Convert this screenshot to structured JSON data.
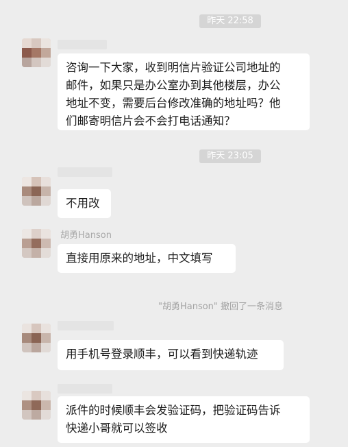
{
  "timestamps": [
    "昨天 22:58",
    "昨天 23:05"
  ],
  "messages": [
    {
      "sender": "",
      "text": "咨询一下大家，收到明信片验证公司地址的\n邮件，如果只是办公室办到其他楼层，办公\n地址不变，需要后台修改准确的地址吗？他\n们邮寄明信片会不会打电话通知？"
    },
    {
      "sender": "",
      "text": "不用改"
    },
    {
      "sender": "胡勇Hanson",
      "text": "直接用原来的地址，中文填写"
    },
    {
      "sender": "",
      "text": "用手机号登录顺丰，可以看到快递轨迹"
    },
    {
      "sender": "",
      "text": "派件的时候顺丰会发验证码，把验证码告诉\n快递小哥就可以签收"
    }
  ],
  "recall_notice": "\"胡勇Hanson\" 撤回了一条消息"
}
